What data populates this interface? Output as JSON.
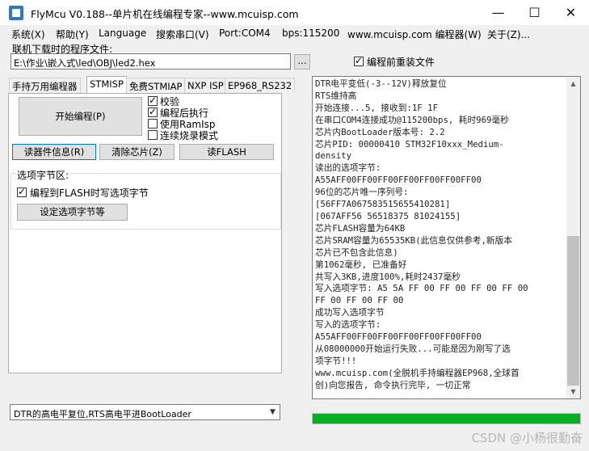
{
  "window": {
    "title": "FlyMcu V0.188--单片机在线编程专家--www.mcuisp.com"
  },
  "window_controls": {
    "minimize": "—",
    "maximize": "☐",
    "close": "✕"
  },
  "menu": [
    "系统(X)",
    "帮助(Y)",
    "Language",
    "搜索串口(V)",
    "Port:COM4",
    "bps:115200",
    "www.mcuisp.com 编程器(W)",
    "关于(Z)..."
  ],
  "file": {
    "label": "联机下载时的程序文件:",
    "path": "E:\\作业\\嵌入式\\led\\OBJ\\led2.hex",
    "browse_label": "...",
    "reload_label": "编程前重装文件",
    "reload_checked": true
  },
  "tabs": [
    "手持万用编程器",
    "STMISP",
    "免费STMIAP",
    "NXP ISP",
    "EP968_RS232"
  ],
  "active_tab": "STMISP",
  "stmisp": {
    "start_label": "开始编程(P)",
    "options": [
      {
        "label": "校验",
        "checked": true
      },
      {
        "label": "编程后执行",
        "checked": true
      },
      {
        "label": "使用RamIsp",
        "checked": false
      },
      {
        "label": "连续烧录模式",
        "checked": false
      }
    ],
    "read_info_label": "读器件信息(R)",
    "erase_label": "清除芯片(Z)",
    "read_flash_label": "读FLASH",
    "option_bytes_title": "选项字节区:",
    "write_option_label": "编程到FLASH时写选项字节",
    "write_option_checked": true,
    "set_option_label": "设定选项字节等"
  },
  "log": [
    "DTR电平变低(-3--12V)释放复位",
    "RTS维持高",
    "开始连接...5, 接收到:1F 1F",
    "在串口COM4连接成功@115200bps, 耗时969毫秒",
    "芯片内BootLoader版本号: 2.2",
    "芯片PID:  00000410  STM32F10xxx_Medium-",
    "density",
    "读出的选项字节:",
    "A55AFF00FF00FF00FF00FF00FF00FF00",
    "96位的芯片唯一序列号:",
    "[56FF7A067583515655410281]",
    "[067AFF56 56518375 81024155]",
    "芯片FLASH容量为64KB",
    "芯片SRAM容量为65535KB(此信息仅供参考,新版本",
    "芯片已不包含此信息)",
    "第1062毫秒, 已准备好",
    "共写入3KB,进度100%,耗时2437毫秒",
    "写入选项字节:  A5 5A FF 00 FF 00 FF 00 FF 00",
    "FF 00 FF 00 FF 00",
    "成功写入选项字节",
    "写入的选项字节:",
    "A55AFF00FF00FF00FF00FF00FF00FF00",
    "从08000000开始运行失败...可能是因为刚写了选",
    "项字节!!!",
    "www.mcuisp.com(全脱机手持编程器EP968,全球首",
    "创)向您报告, 命令执行完毕, 一切正常"
  ],
  "progress": {
    "percent": 100,
    "color": "#06b025"
  },
  "reset_mode": {
    "value": "DTR的高电平复位,RTS高电平进BootLoader"
  },
  "watermark": "CSDN @小杨很勤奋"
}
